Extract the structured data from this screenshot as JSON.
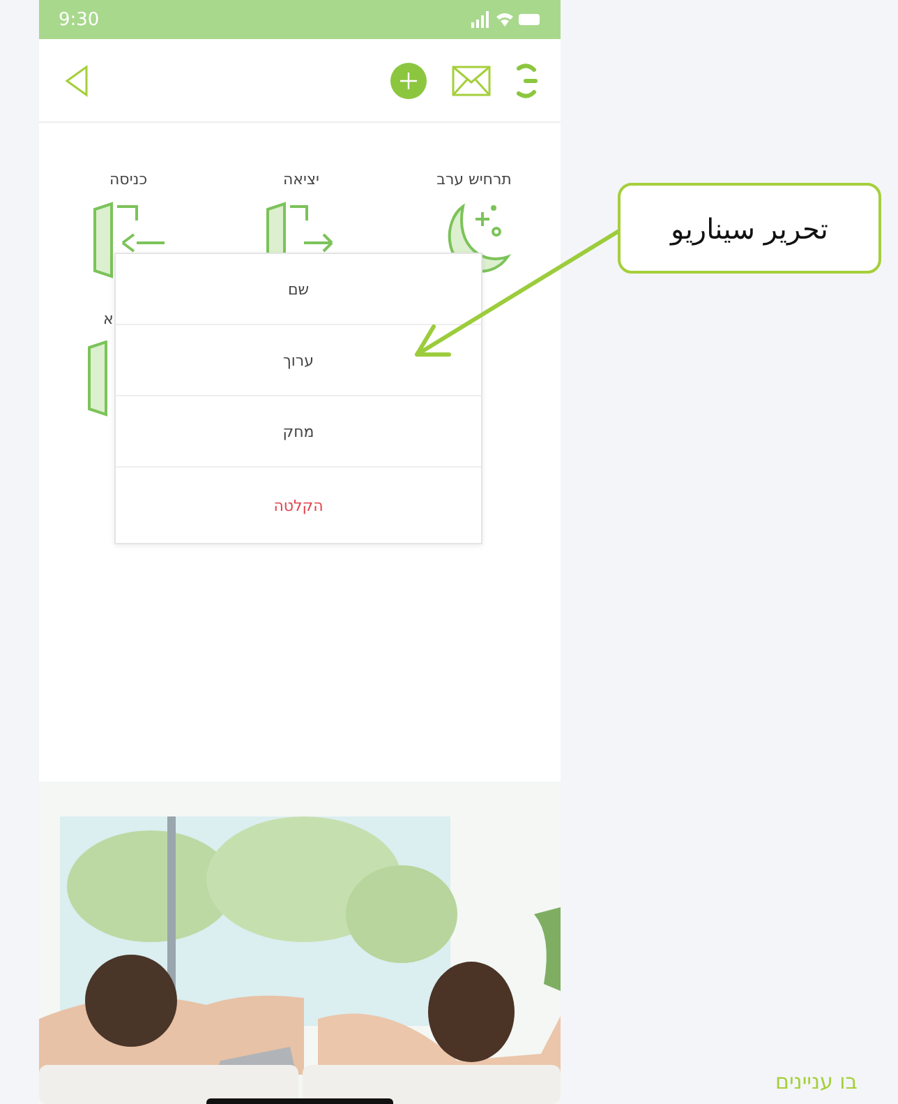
{
  "status_bar": {
    "time": "9:30"
  },
  "scenario_rows": [
    [
      {
        "label": "תרחיש ערב",
        "kind": "moon"
      },
      {
        "label": "יציאה",
        "kind": "exit"
      },
      {
        "label": "כניסה",
        "kind": "enter"
      }
    ],
    [
      {
        "label": "א",
        "kind": "door"
      }
    ]
  ],
  "menu": {
    "items": [
      {
        "label": "שם",
        "kind": "normal"
      },
      {
        "label": "ערוך",
        "kind": "normal"
      },
      {
        "label": "מחק",
        "kind": "normal"
      },
      {
        "label": "הקלטה",
        "kind": "danger"
      }
    ]
  },
  "annotation": {
    "callout": "تحرير سيناريو"
  },
  "footer_link": "בו עניינים"
}
